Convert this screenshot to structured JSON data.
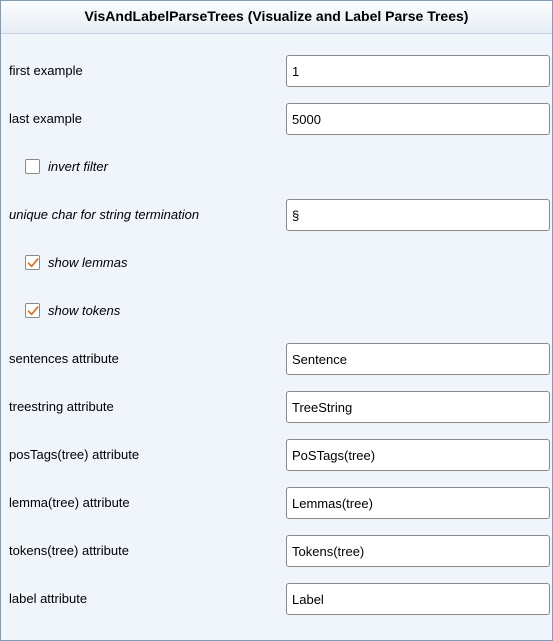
{
  "window": {
    "title": "VisAndLabelParseTrees (Visualize and Label Parse Trees)"
  },
  "fields": {
    "first_example": {
      "label": "first example",
      "value": "1"
    },
    "last_example": {
      "label": "last example",
      "value": "5000"
    },
    "unique_char": {
      "label": "unique char for string termination",
      "value": "§"
    },
    "sentences_attribute": {
      "label": "sentences attribute",
      "value": "Sentence"
    },
    "treestring_attribute": {
      "label": "treestring attribute",
      "value": "TreeString"
    },
    "postags_attribute": {
      "label": "posTags(tree) attribute",
      "value": "PoSTags(tree)"
    },
    "lemma_attribute": {
      "label": "lemma(tree) attribute",
      "value": "Lemmas(tree)"
    },
    "tokens_attribute": {
      "label": "tokens(tree) attribute",
      "value": "Tokens(tree)"
    },
    "label_attribute": {
      "label": "label attribute",
      "value": "Label"
    }
  },
  "checkboxes": {
    "invert_filter": {
      "label": "invert filter",
      "checked": false
    },
    "show_lemmas": {
      "label": "show lemmas",
      "checked": true
    },
    "show_tokens": {
      "label": "show tokens",
      "checked": true
    }
  },
  "colors": {
    "check_mark": "#d9722b",
    "panel_border": "#7f9db9",
    "panel_background": "#f0f5fb"
  }
}
